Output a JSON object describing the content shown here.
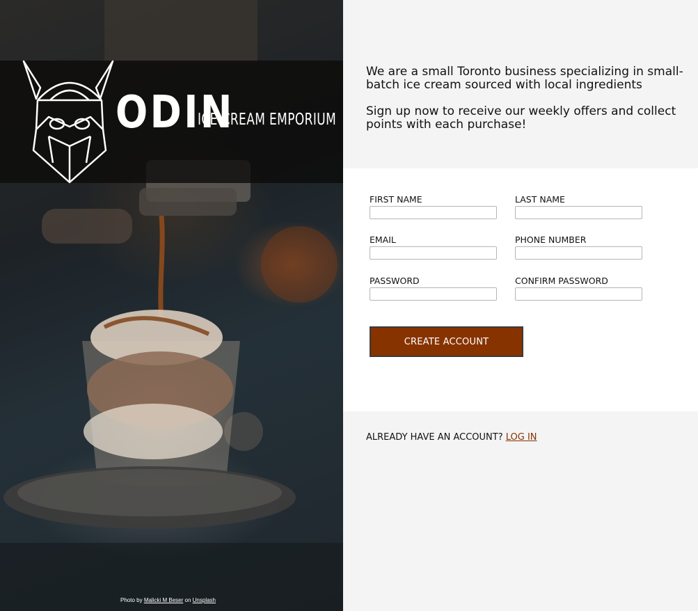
{
  "brand": {
    "name": "ODIN",
    "tagline": "ICE CREAM EMPORIUM"
  },
  "hero": {
    "credit_prefix": "Photo by",
    "credit_author": "Malicki M Beser",
    "credit_mid": "on",
    "credit_source": "Unsplash"
  },
  "intro": {
    "paragraph_1": "We are a small Toronto business specializing in small-batch ice cream sourced with local ingredients",
    "paragraph_2": "Sign up now to receive our weekly offers and collect points with each purchase!"
  },
  "form": {
    "first_name_label": "FIRST NAME",
    "last_name_label": "LAST NAME",
    "email_label": "EMAIL",
    "phone_label": "PHONE NUMBER",
    "password_label": "PASSWORD",
    "confirm_password_label": "CONFIRM PASSWORD",
    "first_name_value": "",
    "last_name_value": "",
    "email_value": "",
    "phone_value": "",
    "password_value": "",
    "confirm_password_value": "",
    "submit_label": "CREATE ACCOUNT"
  },
  "login": {
    "prompt": "ALREADY HAVE AN ACCOUNT?",
    "link_label": "LOG IN"
  },
  "colors": {
    "accent": "#873300",
    "panel_bg": "#f4f4f4",
    "form_bg": "#ffffff"
  }
}
